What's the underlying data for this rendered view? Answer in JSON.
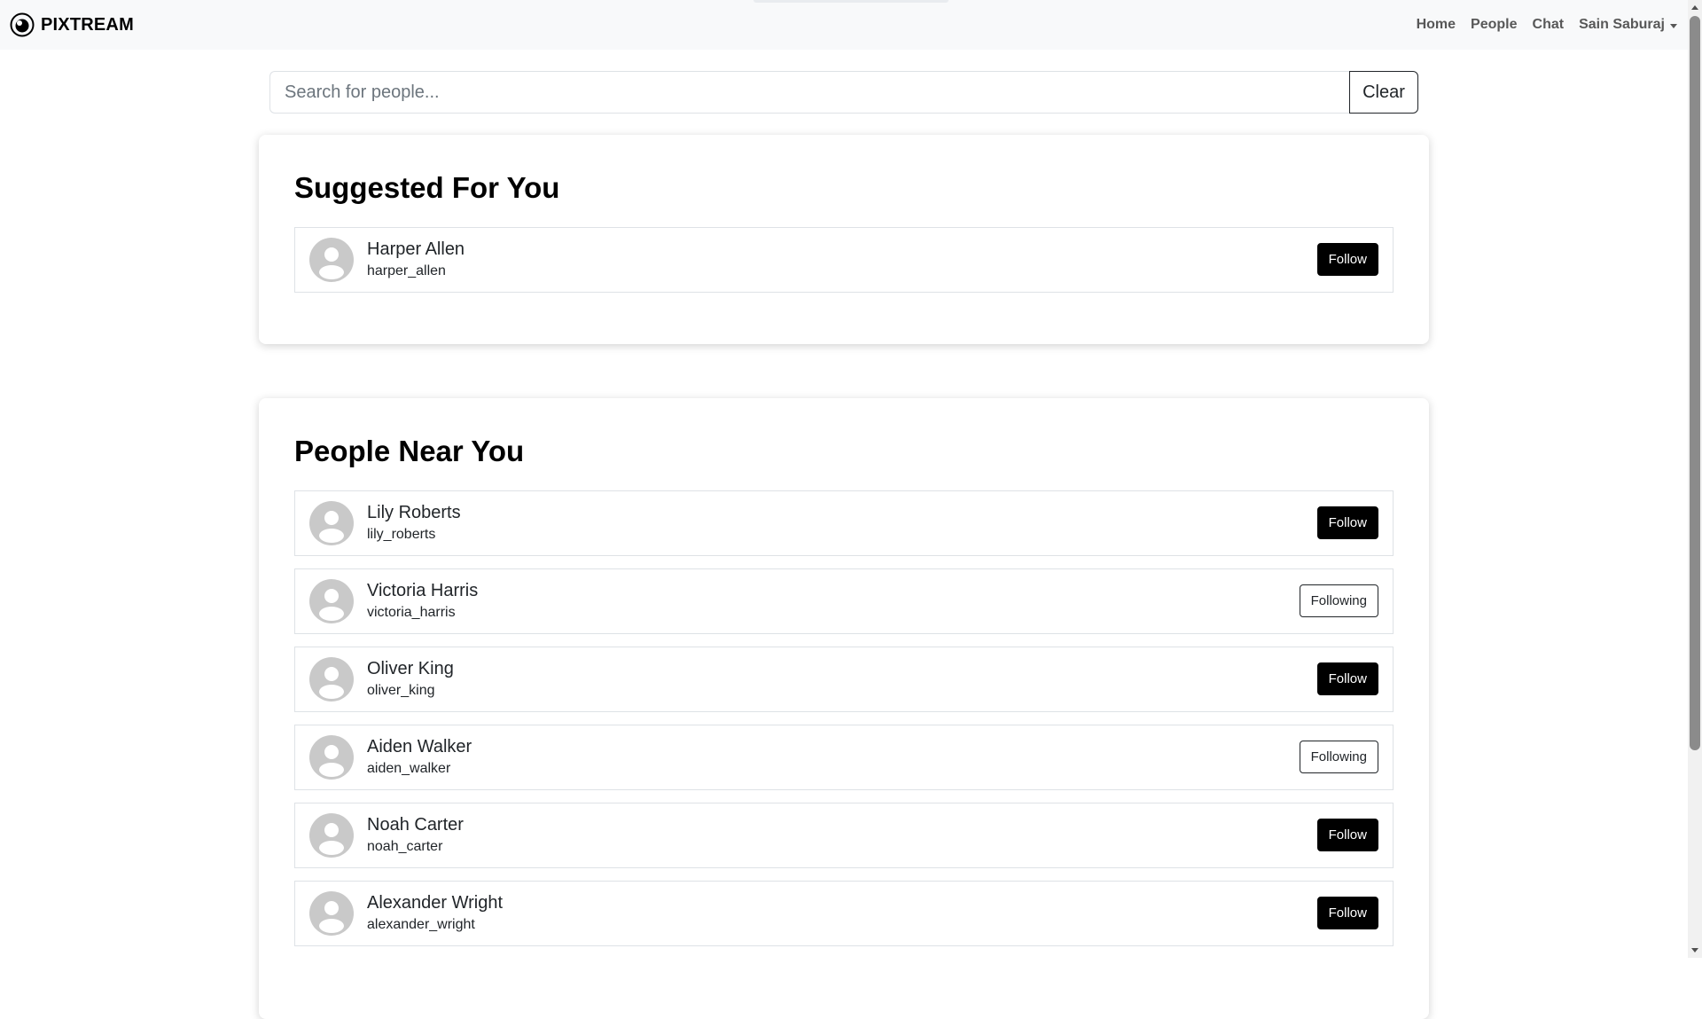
{
  "navbar": {
    "brand": "PIXTREAM",
    "logo_icon": "eye-icon",
    "links": [
      {
        "label": "Home"
      },
      {
        "label": "People"
      },
      {
        "label": "Chat"
      }
    ],
    "user": {
      "label": "Sain Saburaj"
    }
  },
  "search": {
    "placeholder": "Search for people...",
    "value": "",
    "clear_label": "Clear"
  },
  "suggested": {
    "title": "Suggested For You",
    "people": [
      {
        "name": "Harper Allen",
        "handle": "harper_allen",
        "action": "Follow"
      }
    ]
  },
  "near": {
    "title": "People Near You",
    "people": [
      {
        "name": "Lily Roberts",
        "handle": "lily_roberts",
        "action": "Follow"
      },
      {
        "name": "Victoria Harris",
        "handle": "victoria_harris",
        "action": "Following"
      },
      {
        "name": "Oliver King",
        "handle": "oliver_king",
        "action": "Follow"
      },
      {
        "name": "Aiden Walker",
        "handle": "aiden_walker",
        "action": "Following"
      },
      {
        "name": "Noah Carter",
        "handle": "noah_carter",
        "action": "Follow"
      },
      {
        "name": "Alexander Wright",
        "handle": "alexander_wright",
        "action": "Follow"
      }
    ]
  },
  "colors": {
    "navbar_bg": "#f8f9fa",
    "follow_bg": "#000000",
    "avatar_bg": "#c9c9c9"
  }
}
